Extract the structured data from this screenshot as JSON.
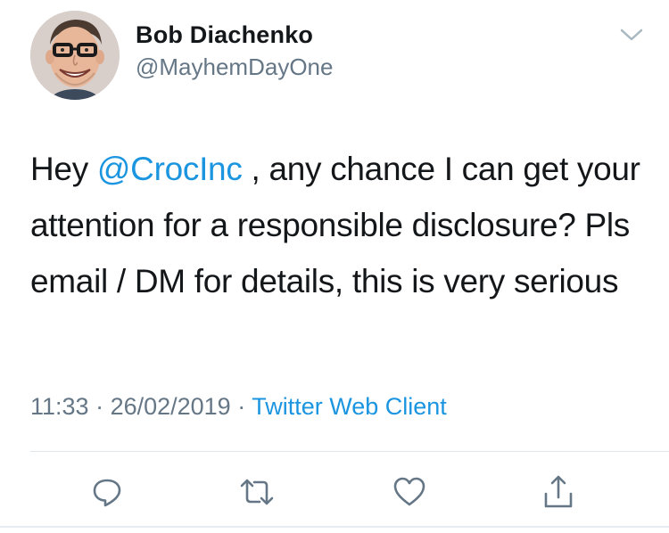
{
  "tweet": {
    "author_name": "Bob Diachenko",
    "author_handle": "@MayhemDayOne",
    "text_before": "Hey ",
    "mention": "@CrocInc",
    "text_after": " , any chance I can get your attention for a responsible disclosure? Pls email / DM for details, this is very serious",
    "time": "11:33",
    "separator_1": " · ",
    "date": "26/02/2019",
    "separator_2": " · ",
    "client": "Twitter Web Client"
  },
  "icons": {
    "more": "chevron-down-icon",
    "reply": "reply-icon",
    "retweet": "retweet-icon",
    "like": "heart-icon",
    "share": "share-icon"
  },
  "colors": {
    "link": "#1b95e0",
    "secondary_text": "#657786",
    "primary_text": "#14171a",
    "divider": "#e1e8ed"
  }
}
